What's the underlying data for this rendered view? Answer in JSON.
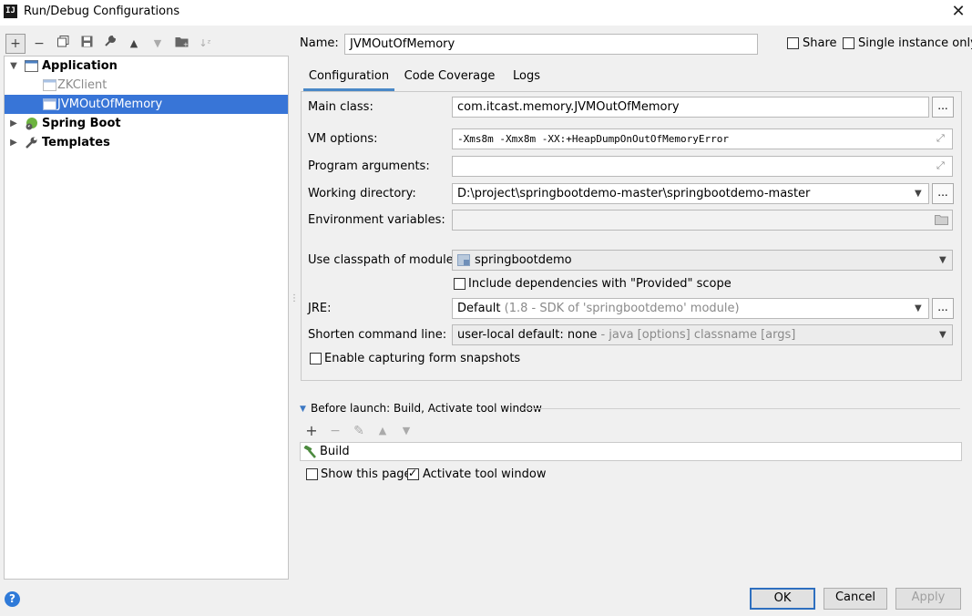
{
  "window": {
    "title": "Run/Debug Configurations",
    "app_icon": "IJ"
  },
  "toolbar": {
    "add": "+",
    "remove": "−",
    "copy": "⧉",
    "save": "💾",
    "edit": "🔧",
    "up": "▲",
    "down": "▼",
    "folder": "📁",
    "sort": "↓ᶻ"
  },
  "tree": {
    "application": "Application",
    "zkclient": "ZKClient",
    "jvm": "JVMOutOfMemory",
    "spring_boot": "Spring Boot",
    "templates": "Templates"
  },
  "header": {
    "name_label": "Name:",
    "name_value": "JVMOutOfMemory",
    "share_label": "Share",
    "single_instance_label": "Single instance only"
  },
  "tabs": [
    "Configuration",
    "Code Coverage",
    "Logs"
  ],
  "form": {
    "main_class_label": "Main class:",
    "main_class_value": "com.itcast.memory.JVMOutOfMemory",
    "vm_options_label": "VM options:",
    "vm_options_value": "-Xms8m -Xmx8m -XX:+HeapDumpOnOutOfMemoryError",
    "program_args_label": "Program arguments:",
    "working_dir_label": "Working directory:",
    "working_dir_value": "D:\\project\\springbootdemo-master\\springbootdemo-master",
    "env_vars_label": "Environment variables:",
    "classpath_label": "Use classpath of module:",
    "classpath_value": "springbootdemo",
    "include_deps_label": "Include dependencies with \"Provided\" scope",
    "jre_label": "JRE:",
    "jre_value": "Default",
    "jre_hint": "(1.8 - SDK of 'springbootdemo' module)",
    "shorten_label": "Shorten command line:",
    "shorten_value": "user-local default: none",
    "shorten_hint": "- java [options] classname [args]",
    "snapshots_label": "Enable capturing form snapshots",
    "dots": "..."
  },
  "before_launch": {
    "header": "Before launch: Build, Activate tool window",
    "item": "Build",
    "show_page_label": "Show this page",
    "activate_label": "Activate tool window"
  },
  "buttons": {
    "ok": "OK",
    "cancel": "Cancel",
    "apply": "Apply",
    "help": "?"
  }
}
